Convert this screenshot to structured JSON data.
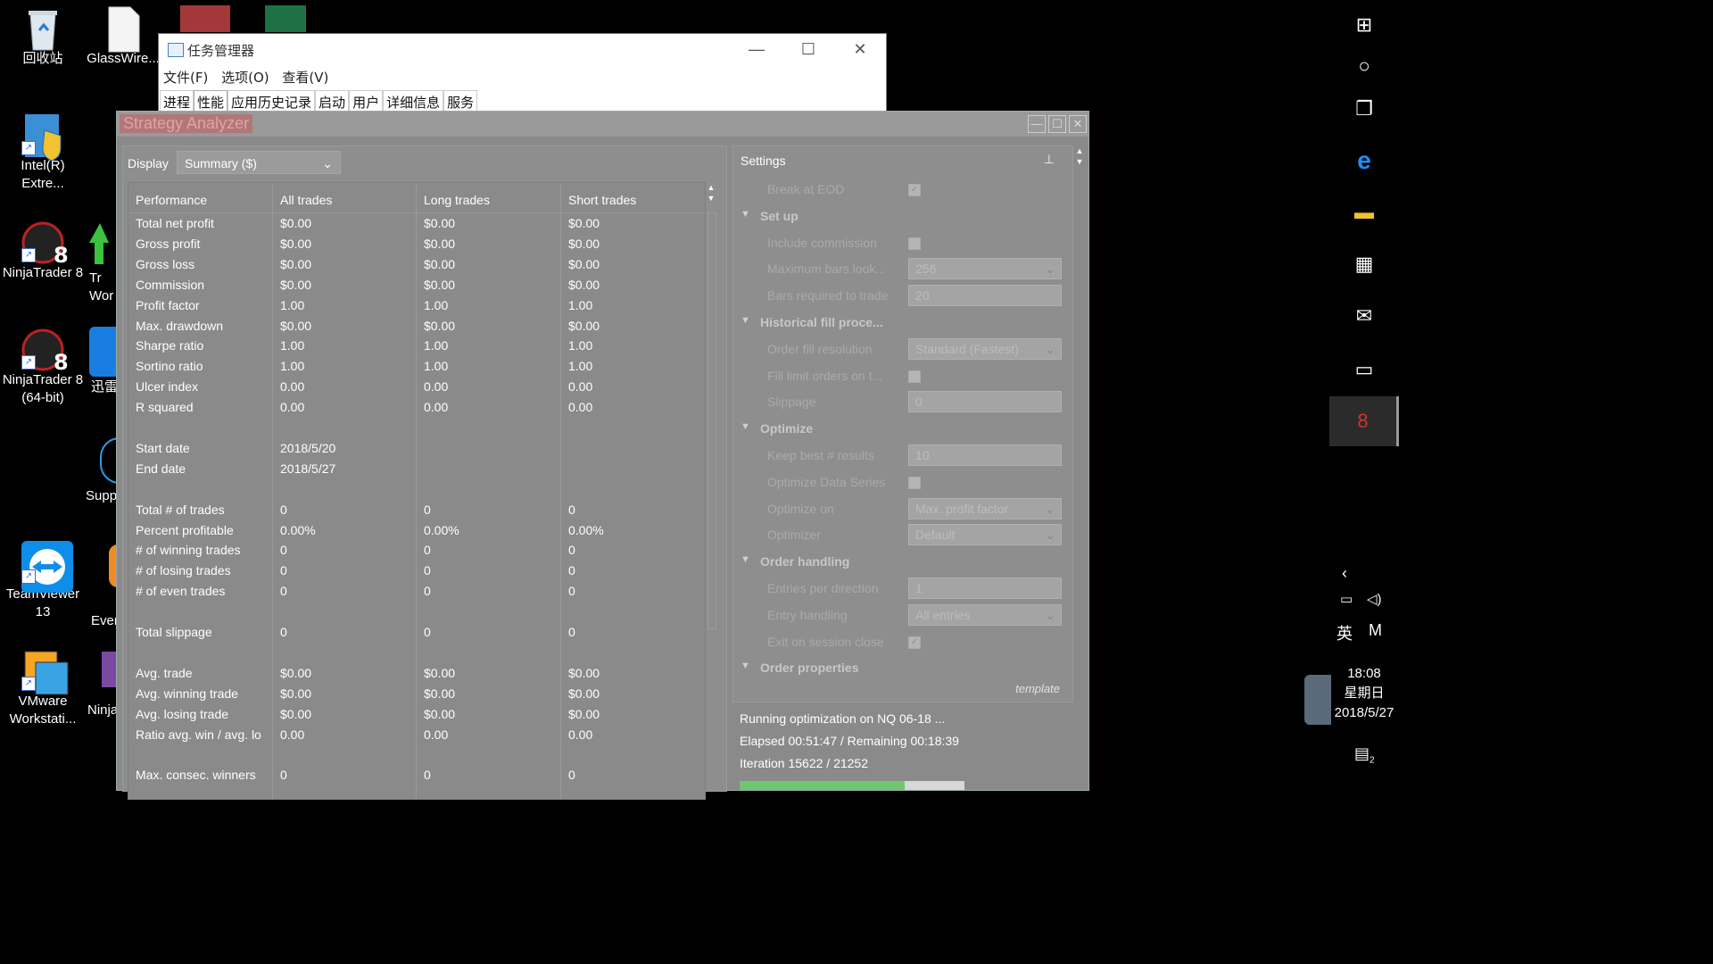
{
  "desktop": {
    "icons": [
      {
        "label": "回收站"
      },
      {
        "label": "GlassWire..."
      },
      {
        "label": "Intel(R) Extre..."
      },
      {
        "label": "NinjaTrader 8"
      },
      {
        "label": "NinjaTrader 8 (64-bit)"
      },
      {
        "label": "TeamViewer 13"
      },
      {
        "label": "VMware Workstati..."
      },
      {
        "label": "Tr Wor"
      },
      {
        "label": "迅雷"
      },
      {
        "label": "Supp"
      },
      {
        "label": "Ever"
      },
      {
        "label": "Ninja"
      }
    ]
  },
  "taskmgr": {
    "title": "任务管理器",
    "menu": [
      "文件(F)",
      "选项(O)",
      "查看(V)"
    ],
    "tabs": [
      "进程",
      "性能",
      "应用历史记录",
      "启动",
      "用户",
      "详细信息",
      "服务"
    ],
    "minimize": "—",
    "maximize": "☐",
    "close": "✕"
  },
  "analyzer": {
    "title": "Strategy Analyzer",
    "display_label": "Display",
    "display_value": "Summary ($)",
    "columns": [
      "Performance",
      "All trades",
      "Long trades",
      "Short trades"
    ],
    "rows": [
      [
        "Total net profit",
        "$0.00",
        "$0.00",
        "$0.00"
      ],
      [
        "Gross profit",
        "$0.00",
        "$0.00",
        "$0.00"
      ],
      [
        "Gross loss",
        "$0.00",
        "$0.00",
        "$0.00"
      ],
      [
        "Commission",
        "$0.00",
        "$0.00",
        "$0.00"
      ],
      [
        "Profit factor",
        "1.00",
        "1.00",
        "1.00"
      ],
      [
        "Max. drawdown",
        "$0.00",
        "$0.00",
        "$0.00"
      ],
      [
        "Sharpe ratio",
        "1.00",
        "1.00",
        "1.00"
      ],
      [
        "Sortino ratio",
        "1.00",
        "1.00",
        "1.00"
      ],
      [
        "Ulcer index",
        "0.00",
        "0.00",
        "0.00"
      ],
      [
        "R squared",
        "0.00",
        "0.00",
        "0.00"
      ],
      [
        "",
        "",
        "",
        ""
      ],
      [
        "Start date",
        "2018/5/20",
        "",
        ""
      ],
      [
        "End date",
        "2018/5/27",
        "",
        ""
      ],
      [
        "",
        "",
        "",
        ""
      ],
      [
        "Total # of trades",
        "0",
        "0",
        "0"
      ],
      [
        "Percent profitable",
        "0.00%",
        "0.00%",
        "0.00%"
      ],
      [
        "# of winning trades",
        "0",
        "0",
        "0"
      ],
      [
        "# of losing trades",
        "0",
        "0",
        "0"
      ],
      [
        "# of even trades",
        "0",
        "0",
        "0"
      ],
      [
        "",
        "",
        "",
        ""
      ],
      [
        "Total slippage",
        "0",
        "0",
        "0"
      ],
      [
        "",
        "",
        "",
        ""
      ],
      [
        "Avg. trade",
        "$0.00",
        "$0.00",
        "$0.00"
      ],
      [
        "Avg. winning trade",
        "$0.00",
        "$0.00",
        "$0.00"
      ],
      [
        "Avg. losing trade",
        "$0.00",
        "$0.00",
        "$0.00"
      ],
      [
        "Ratio avg. win / avg. lo",
        "0.00",
        "0.00",
        "0.00"
      ],
      [
        "",
        "",
        "",
        ""
      ],
      [
        "Max. consec. winners",
        "0",
        "0",
        "0"
      ]
    ],
    "settings": {
      "header": "Settings",
      "items": [
        {
          "type": "check",
          "label": "Break at EOD",
          "checked": true
        },
        {
          "type": "cat",
          "label": "Set up"
        },
        {
          "type": "check",
          "label": "Include commission",
          "checked": false
        },
        {
          "type": "select",
          "label": "Maximum bars look...",
          "value": "256"
        },
        {
          "type": "input",
          "label": "Bars required to trade",
          "value": "20"
        },
        {
          "type": "cat",
          "label": "Historical fill proce..."
        },
        {
          "type": "select",
          "label": "Order fill resolution",
          "value": "Standard (Fastest)"
        },
        {
          "type": "check",
          "label": "Fill limit orders on t...",
          "checked": false
        },
        {
          "type": "input",
          "label": "Slippage",
          "value": "0"
        },
        {
          "type": "cat",
          "label": "Optimize"
        },
        {
          "type": "input",
          "label": "Keep best # results",
          "value": "10"
        },
        {
          "type": "check",
          "label": "Optimize Data Series",
          "checked": false
        },
        {
          "type": "select",
          "label": "Optimize on",
          "value": "Max. profit factor"
        },
        {
          "type": "select",
          "label": "Optimizer",
          "value": "Default"
        },
        {
          "type": "cat",
          "label": "Order handling"
        },
        {
          "type": "input",
          "label": "Entries per direction",
          "value": "1"
        },
        {
          "type": "select",
          "label": "Entry handling",
          "value": "All entries"
        },
        {
          "type": "check",
          "label": "Exit on session close",
          "checked": true
        },
        {
          "type": "cat",
          "label": "Order properties"
        }
      ],
      "template_label": "template"
    },
    "status": {
      "line1": "Running optimization on NQ 06-18 ...",
      "line2": "Elapsed 00:51:47 / Remaining 00:18:39",
      "line3": "Iteration 15622 / 21252",
      "progress": 0.735
    }
  },
  "taskbar": {
    "time": "18:08",
    "weekday": "星期日",
    "date": "2018/5/27",
    "ime": "英",
    "ime2": "M",
    "notifications": "2"
  }
}
